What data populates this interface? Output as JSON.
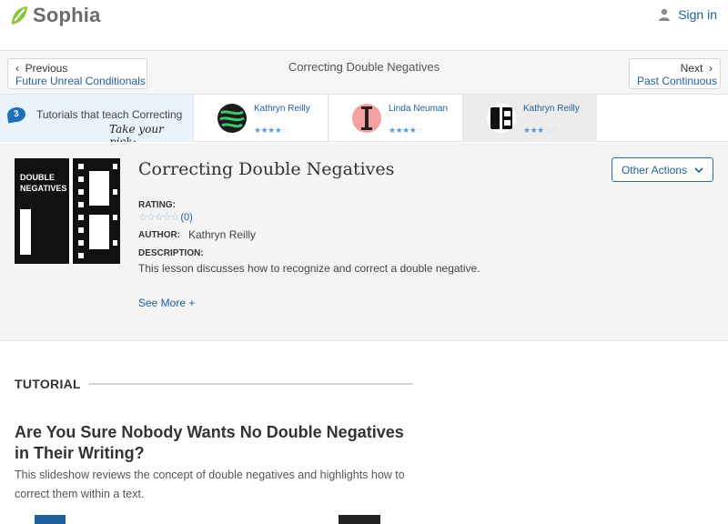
{
  "header": {
    "brand": "Sophia",
    "signin_label": "Sign in",
    "colors": {
      "brand_green": "#8bc53f",
      "link": "#1e5f9c"
    }
  },
  "navbar": {
    "prev_small": "Previous",
    "prev_link": "Future Unreal Conditionals",
    "title": "Correcting Double Negatives",
    "next_small": "Next",
    "next_link": "Past Continuous"
  },
  "strip": {
    "count": "3",
    "label": "Tutorials that teach Correcting Double Negatives",
    "take_pick": "Take your pick:",
    "tutorials": [
      {
        "author": "Kathryn Reilly",
        "rating": 4,
        "icon": "green-scribble-avatar"
      },
      {
        "author": "Linda Neuman",
        "rating": 4,
        "icon": "pink-pillar-avatar"
      },
      {
        "author": "Kathryn Reilly",
        "rating": 3,
        "icon": "film-strip-avatar"
      }
    ]
  },
  "lesson": {
    "thumb_text_1": "DOUBLE",
    "thumb_text_2": "NEGATIVES",
    "title": "Correcting Double Negatives",
    "other_actions": "Other Actions",
    "rating_label": "RATING:",
    "rating_count": "(0)",
    "author_label": "AUTHOR:",
    "author": "Kathryn Reilly",
    "description_label": "DESCRIPTION:",
    "description": "This lesson discusses how to recognize and correct a double negative.",
    "see_more": "See More +"
  },
  "tutorial": {
    "section_label": "TUTORIAL",
    "title": "Are You Sure Nobody Wants No Double Negatives in Their Writing?",
    "description": "This slideshow reviews the concept of double negatives and highlights how to correct them within a text."
  }
}
